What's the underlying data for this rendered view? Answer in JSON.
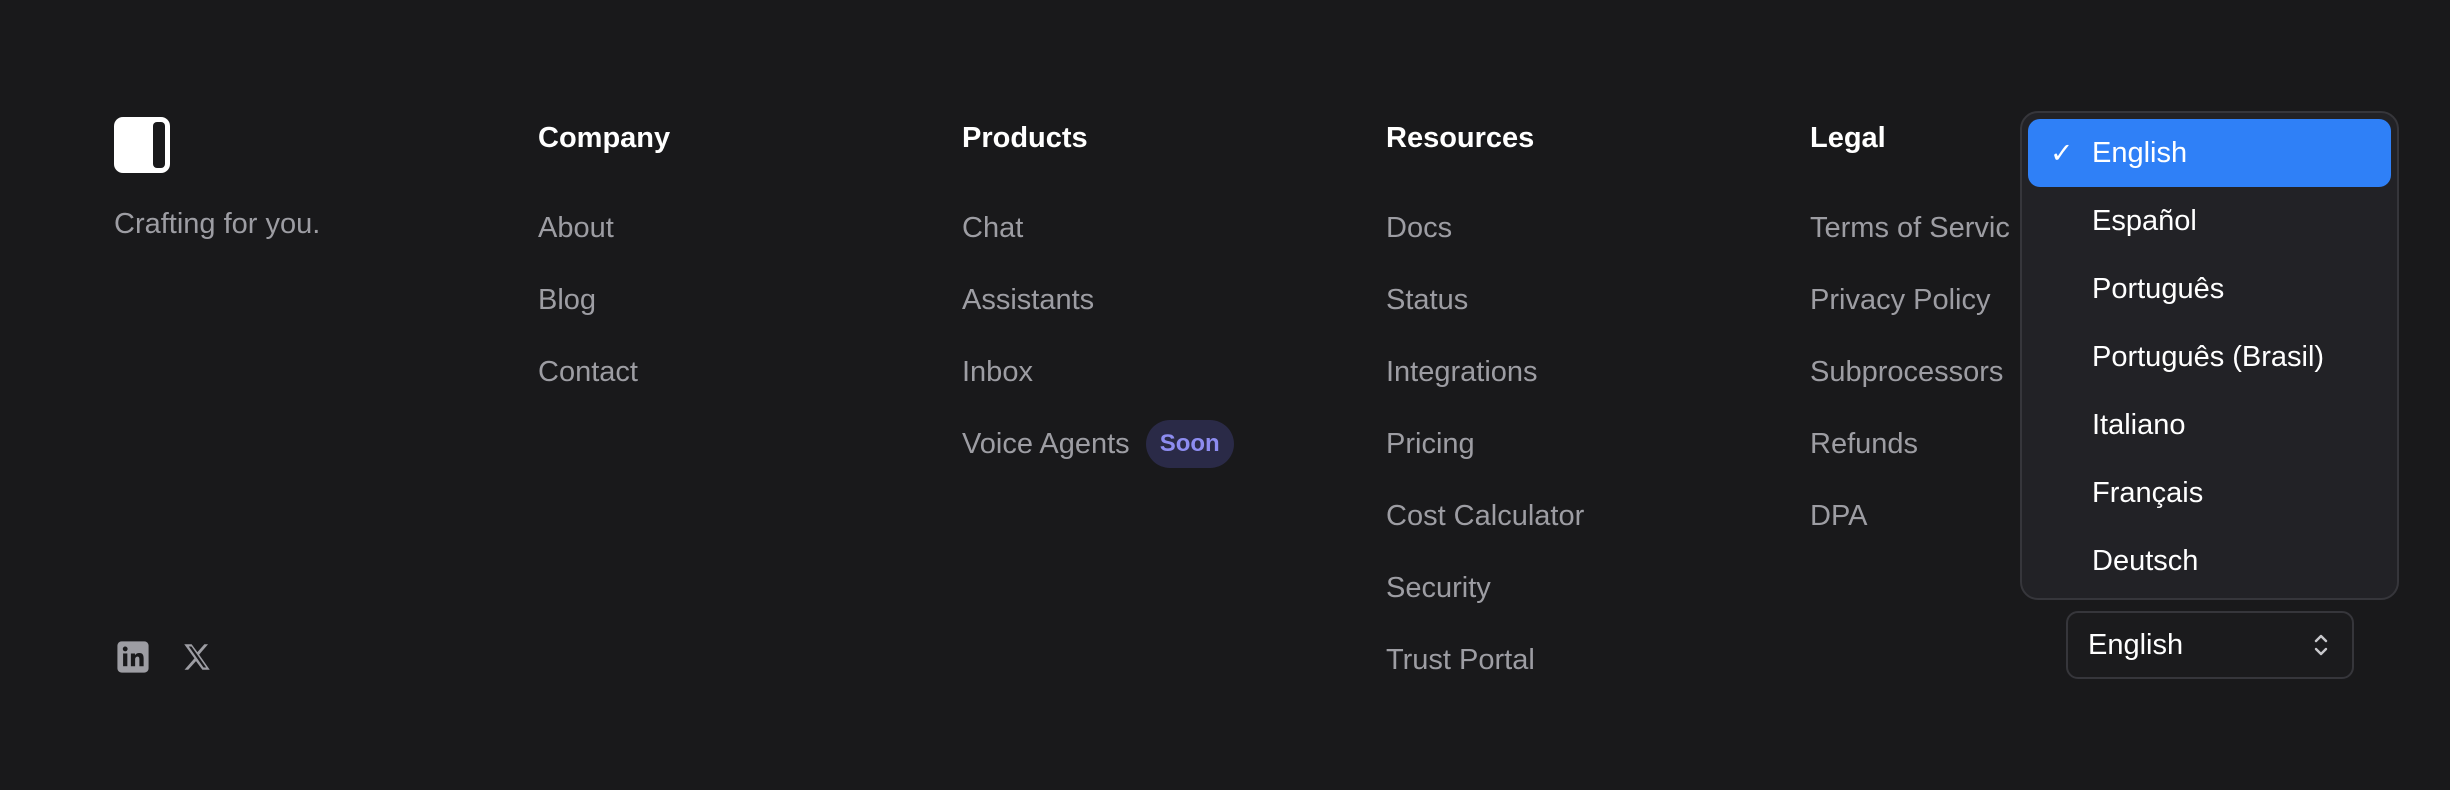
{
  "brand": {
    "tagline": "Crafting for you."
  },
  "columns": [
    {
      "title": "Company",
      "links": [
        {
          "label": "About"
        },
        {
          "label": "Blog"
        },
        {
          "label": "Contact"
        }
      ]
    },
    {
      "title": "Products",
      "links": [
        {
          "label": "Chat"
        },
        {
          "label": "Assistants"
        },
        {
          "label": "Inbox"
        },
        {
          "label": "Voice Agents",
          "badge": "Soon"
        }
      ]
    },
    {
      "title": "Resources",
      "links": [
        {
          "label": "Docs"
        },
        {
          "label": "Status"
        },
        {
          "label": "Integrations"
        },
        {
          "label": "Pricing"
        },
        {
          "label": "Cost Calculator"
        },
        {
          "label": "Security"
        },
        {
          "label": "Trust Portal"
        }
      ]
    },
    {
      "title": "Legal",
      "links": [
        {
          "label": "Terms of Servic"
        },
        {
          "label": "Privacy Policy"
        },
        {
          "label": "Subprocessors"
        },
        {
          "label": "Refunds"
        },
        {
          "label": "DPA"
        }
      ]
    }
  ],
  "social": {
    "icons": [
      "linkedin-icon",
      "x-icon"
    ]
  },
  "language": {
    "selected": "English",
    "options": [
      "English",
      "Español",
      "Português",
      "Português (Brasil)",
      "Italiano",
      "Français",
      "Deutsch"
    ],
    "check_glyph": "✓"
  },
  "colors": {
    "background": "#19191b",
    "accent": "#2f80f7",
    "badge_bg": "#2a2a47",
    "badge_text": "#8d8cf0"
  }
}
